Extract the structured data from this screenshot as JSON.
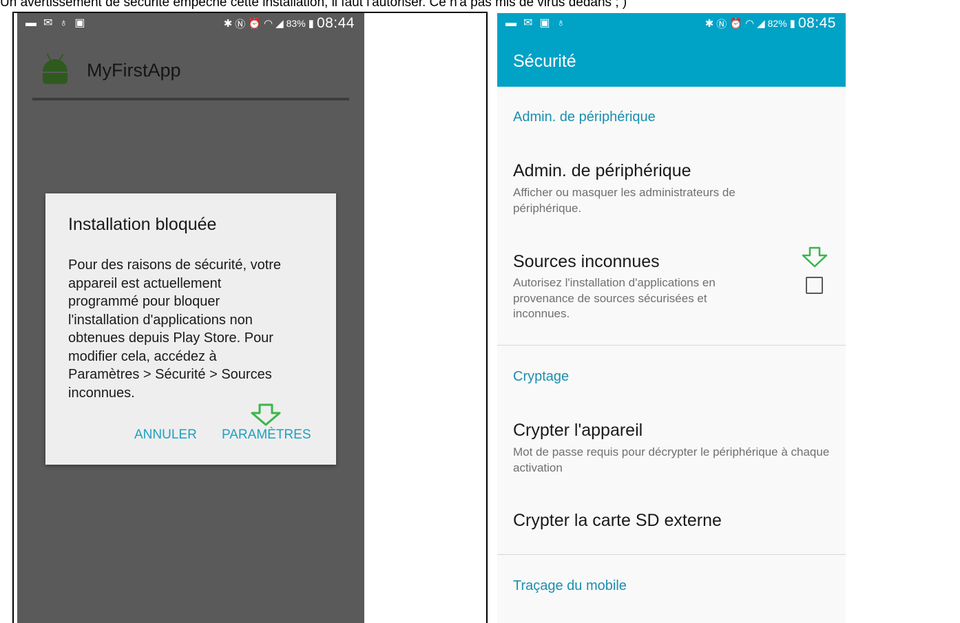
{
  "caption": "Un avertissement de sécurité empêche cette installation, il faut l'autoriser. Ce n'a pas mis de virus dedans ; )",
  "left": {
    "statusbar": {
      "battery": "83%",
      "time": "08:44"
    },
    "app_title": "MyFirstApp",
    "dialog": {
      "title": "Installation bloquée",
      "message": "Pour des raisons de sécurité, votre\nappareil est actuellement\nprogrammé pour bloquer\nl'installation d'applications non\nobtenues depuis Play Store. Pour\nmodifier cela, accédez à\nParamètres > Sécurité > Sources\ninconnues.",
      "cancel_label": "ANNULER",
      "settings_label": "PARAMÈTRES"
    }
  },
  "right": {
    "statusbar": {
      "battery": "82%",
      "time": "08:45"
    },
    "toolbar_title": "Sécurité",
    "section_device_admin": "Admin. de périphérique",
    "pref_device_admin": {
      "title": "Admin. de périphérique",
      "summary": "Afficher ou masquer les administrateurs de périphérique."
    },
    "pref_unknown_sources": {
      "title": "Sources inconnues",
      "summary": "Autorisez l'installation d'applications en provenance de sources sécurisées et inconnues.",
      "checked": false
    },
    "section_encryption": "Cryptage",
    "pref_encrypt_device": {
      "title": "Crypter l'appareil",
      "summary": "Mot de passe requis pour décrypter le périphérique à chaque activation"
    },
    "pref_encrypt_sd": {
      "title": "Crypter la carte SD externe"
    },
    "section_tracking": "Traçage du mobile"
  },
  "colors": {
    "accent": "#00a2c6",
    "section": "#1a8fae",
    "annotation_arrow": "#3bb54a"
  }
}
